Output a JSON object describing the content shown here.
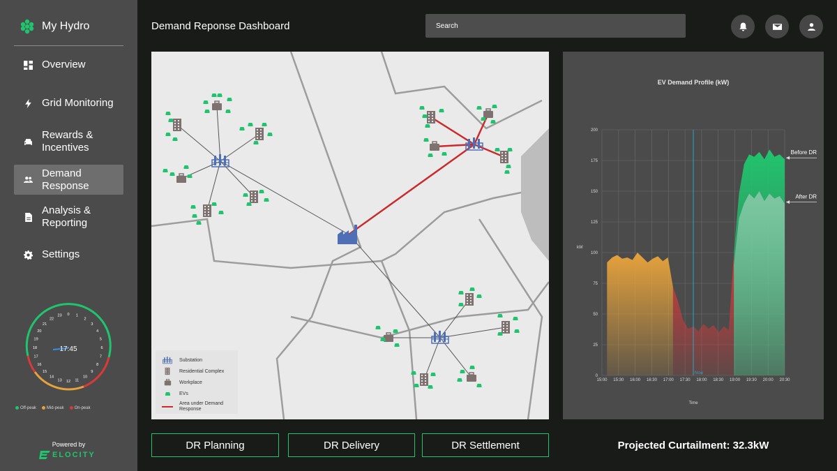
{
  "brand": {
    "name": "My Hydro",
    "powered_by": "Powered by",
    "logo_text": "ELOCITY"
  },
  "nav": [
    {
      "label": "Overview",
      "icon": "dashboard-icon"
    },
    {
      "label": "Grid Monitoring",
      "icon": "lightning-icon"
    },
    {
      "label": "Rewards & Incentives",
      "icon": "car-icon"
    },
    {
      "label": "Demand Response",
      "icon": "people-icon",
      "active": true
    },
    {
      "label": "Analysis & Reporting",
      "icon": "document-icon"
    },
    {
      "label": "Settings",
      "icon": "gear-icon"
    }
  ],
  "clock": {
    "time": "17:45",
    "hours": [
      "0",
      "1",
      "2",
      "3",
      "4",
      "5",
      "6",
      "7",
      "8",
      "9",
      "10",
      "11",
      "12",
      "13",
      "14",
      "15",
      "16",
      "17",
      "18",
      "19",
      "20",
      "21",
      "22",
      "23"
    ],
    "legend": {
      "off_peak": "Off-peak",
      "mid_peak": "Mid-peak",
      "on_peak": "On-peak"
    },
    "colors": {
      "off_peak": "#21c46e",
      "mid_peak": "#e6a23c",
      "on_peak": "#d83a3a"
    }
  },
  "header": {
    "title": "Demand Reponse Dashboard",
    "search_placeholder": "Search",
    "icons": [
      "bell-icon",
      "mail-icon",
      "user-icon"
    ]
  },
  "map": {
    "legend": {
      "substation": "Substation",
      "residential": "Residential Complex",
      "workplace": "Workplace",
      "evs": "EVs",
      "dr_area": "Area under Demand Response"
    }
  },
  "chart_data": {
    "type": "area",
    "title": "EV Demand Profile (kW)",
    "xlabel": "Time",
    "ylabel": "kW",
    "ylim": [
      0,
      200
    ],
    "y_ticks": [
      "0",
      "25",
      "50",
      "75",
      "100",
      "125",
      "150",
      "175",
      "200"
    ],
    "x_ticks": [
      "15:00",
      "15:30",
      "16:00",
      "16:30",
      "17:00",
      "17:30",
      "18:00",
      "18:30",
      "19:00",
      "19:30",
      "20:00",
      "20:30"
    ],
    "now_label": "Now",
    "now_time": "17:45",
    "annotations": [
      "Before DR",
      "After DR"
    ],
    "series": [
      {
        "name": "Before DR",
        "values": [
          0,
          92,
          96,
          98,
          95,
          96,
          94,
          100,
          96,
          92,
          95,
          97,
          93,
          96,
          72,
          60,
          45,
          38,
          40,
          36,
          42,
          38,
          41,
          35,
          40,
          37,
          100,
          148,
          172,
          180,
          178,
          182,
          176,
          184,
          178,
          180,
          176
        ]
      },
      {
        "name": "After DR",
        "values": [
          0,
          92,
          96,
          98,
          95,
          96,
          94,
          100,
          96,
          92,
          95,
          97,
          93,
          96,
          72,
          60,
          45,
          38,
          40,
          36,
          42,
          38,
          41,
          35,
          40,
          37,
          90,
          128,
          140,
          148,
          144,
          150,
          142,
          148,
          144,
          146,
          140
        ]
      }
    ],
    "grid": true,
    "colors": {
      "yellow": "#e6a23c",
      "red": "#d83a3a",
      "green": "#21c46e",
      "now": "#22a7c9"
    }
  },
  "bottom": {
    "dr_planning": "DR Planning",
    "dr_delivery": "DR Delivery",
    "dr_settlement": "DR Settlement",
    "curtailment": "Projected Curtailment: 32.3kW"
  }
}
